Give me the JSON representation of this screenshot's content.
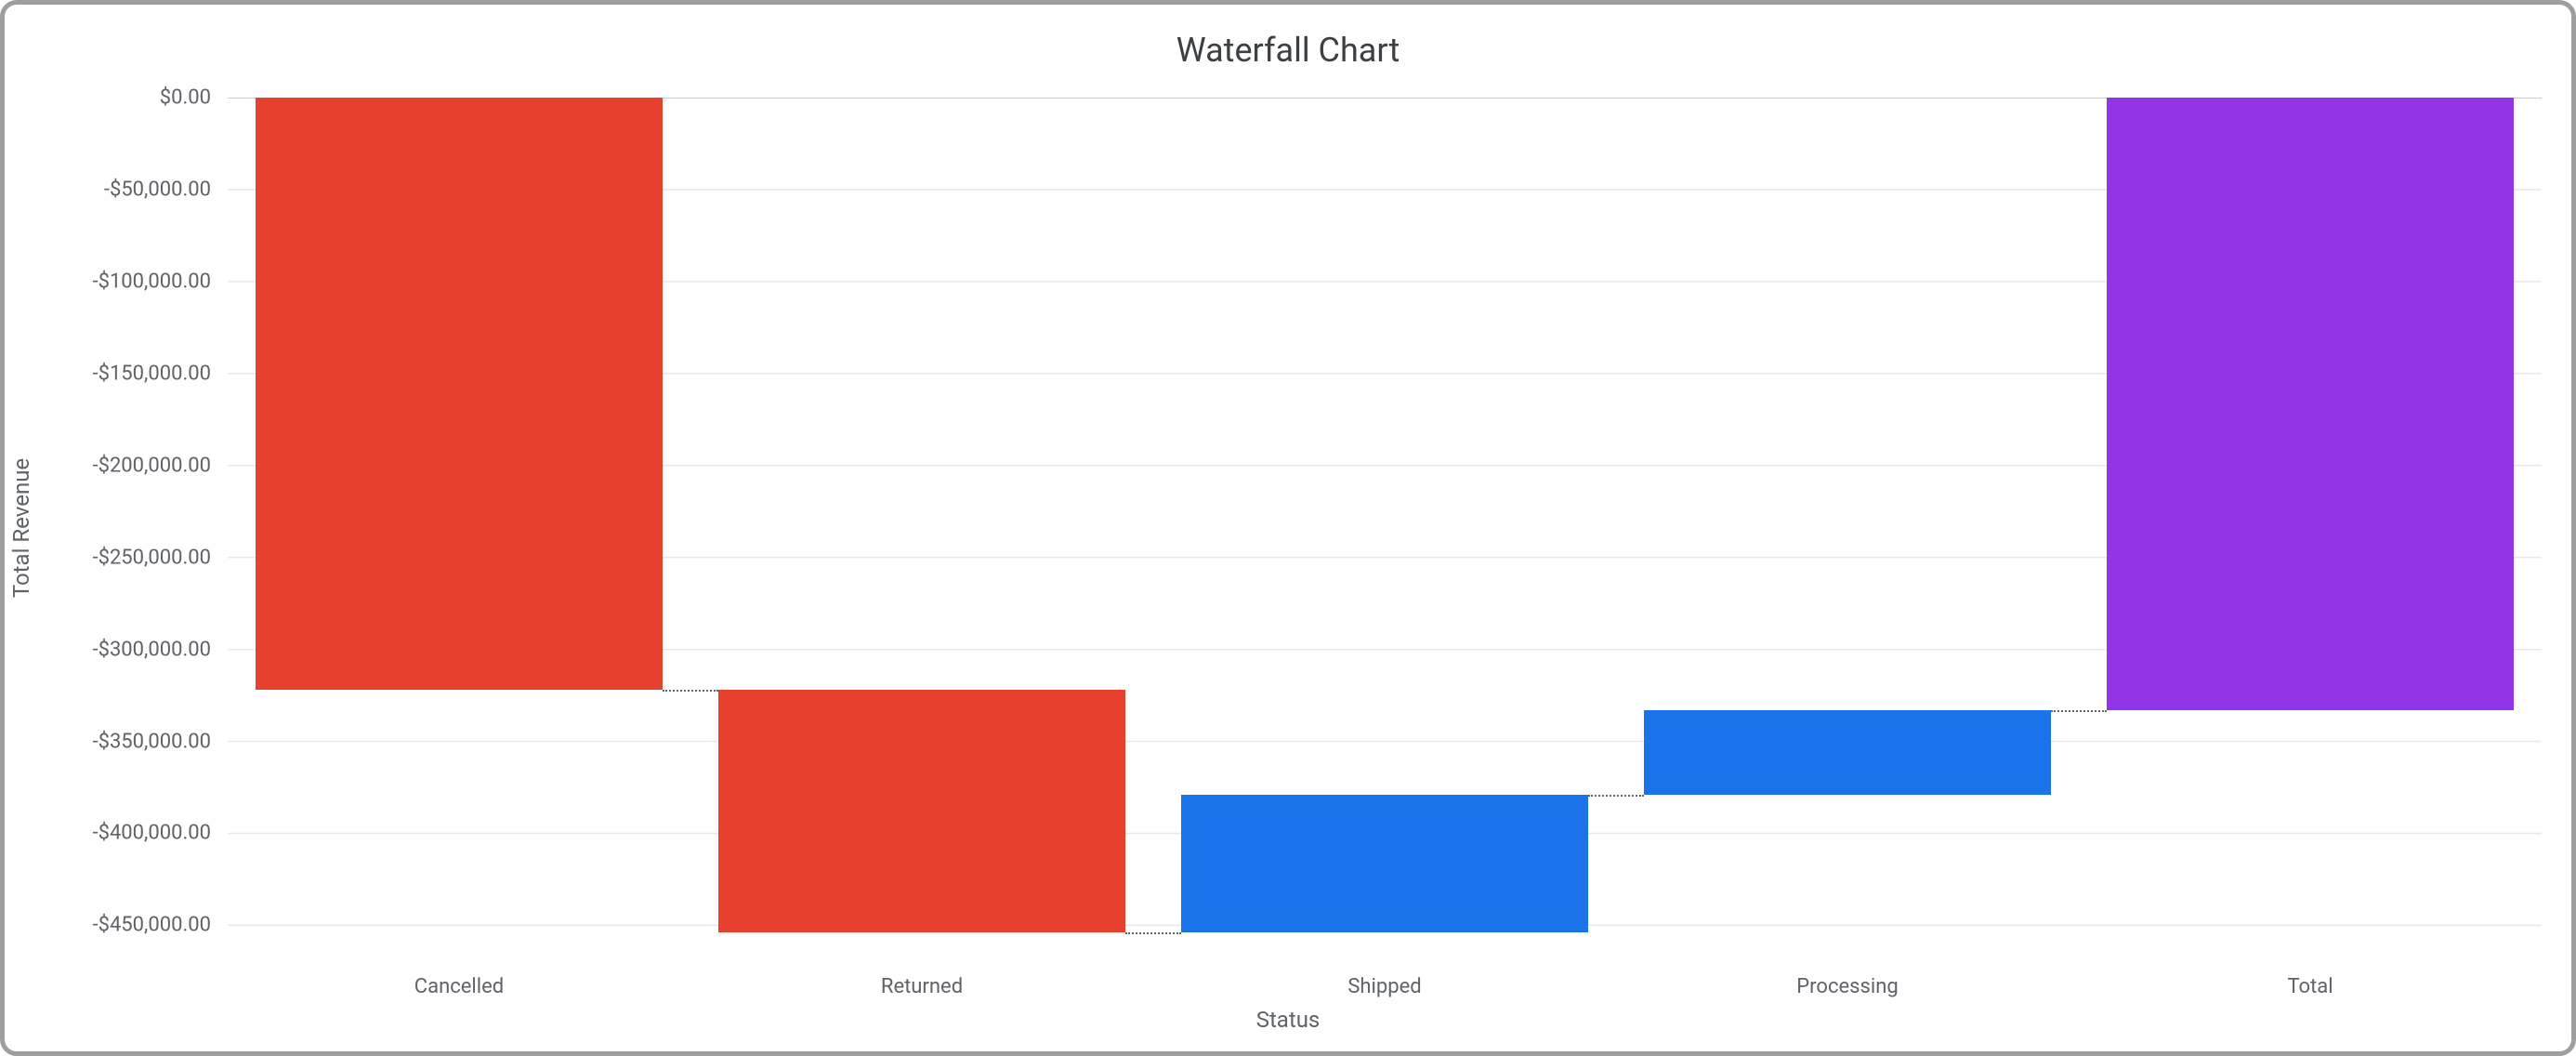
{
  "chart_data": {
    "type": "waterfall",
    "title": "Waterfall Chart",
    "xlabel": "Status",
    "ylabel": "Total Revenue",
    "ylim": [
      -470000,
      0
    ],
    "y_ticks": [
      0,
      -50000,
      -100000,
      -150000,
      -200000,
      -250000,
      -300000,
      -350000,
      -400000,
      -450000
    ],
    "y_tick_labels": [
      "$0.00",
      "-$50,000.00",
      "-$100,000.00",
      "-$150,000.00",
      "-$200,000.00",
      "-$250,000.00",
      "-$300,000.00",
      "-$350,000.00",
      "-$400,000.00",
      "-$450,000.00"
    ],
    "categories": [
      "Cancelled",
      "Returned",
      "Shipped",
      "Processing",
      "Total"
    ],
    "bars": [
      {
        "label": "Cancelled",
        "start": 0,
        "end": -322000,
        "delta": -322000,
        "kind": "decrease",
        "color": "#e8402f"
      },
      {
        "label": "Returned",
        "start": -322000,
        "end": -454000,
        "delta": -132000,
        "kind": "decrease",
        "color": "#e8402f"
      },
      {
        "label": "Shipped",
        "start": -454000,
        "end": -379000,
        "delta": 75000,
        "kind": "increase",
        "color": "#1a73e8"
      },
      {
        "label": "Processing",
        "start": -379000,
        "end": -333000,
        "delta": 46000,
        "kind": "increase",
        "color": "#1a73e8"
      },
      {
        "label": "Total",
        "start": 0,
        "end": -333000,
        "delta": -333000,
        "kind": "total",
        "color": "#9334e6"
      }
    ]
  }
}
